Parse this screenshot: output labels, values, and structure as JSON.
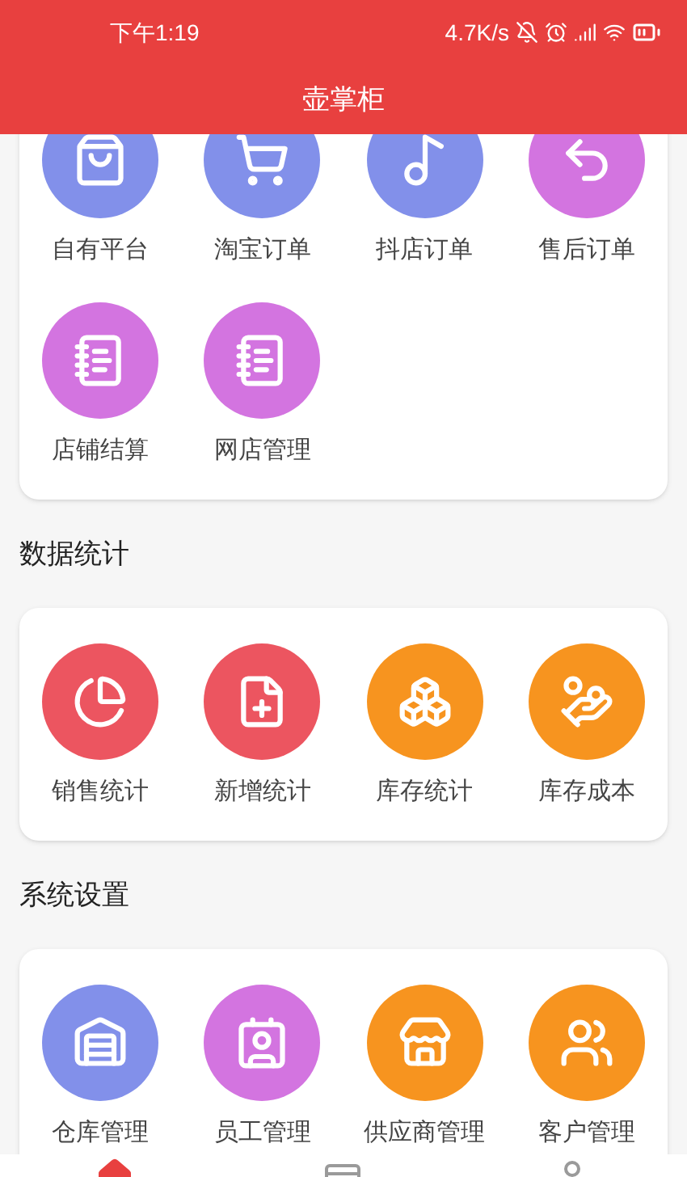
{
  "status_bar": {
    "time": "下午1:19",
    "net_speed": "4.7K/s"
  },
  "header": {
    "title": "壶掌柜"
  },
  "sections": [
    {
      "items": [
        {
          "label": "自有平台",
          "color": "#8290ea"
        },
        {
          "label": "淘宝订单",
          "color": "#8290ea"
        },
        {
          "label": "抖店订单",
          "color": "#8290ea"
        },
        {
          "label": "售后订单",
          "color": "#d374e0"
        },
        {
          "label": "店铺结算",
          "color": "#d374e0"
        },
        {
          "label": "网店管理",
          "color": "#d374e0"
        }
      ]
    },
    {
      "title": "数据统计",
      "items": [
        {
          "label": "销售统计",
          "color": "#ec5560"
        },
        {
          "label": "新增统计",
          "color": "#ec5560"
        },
        {
          "label": "库存统计",
          "color": "#f7941f"
        },
        {
          "label": "库存成本",
          "color": "#f7941f"
        }
      ]
    },
    {
      "title": "系统设置",
      "items": [
        {
          "label": "仓库管理",
          "color": "#8290ea"
        },
        {
          "label": "员工管理",
          "color": "#d374e0"
        },
        {
          "label": "供应商管理",
          "color": "#f7941f"
        },
        {
          "label": "客户管理",
          "color": "#f7941f"
        }
      ]
    }
  ],
  "tab_bar": [
    {
      "selected": true
    },
    {
      "selected": false
    },
    {
      "selected": false
    }
  ]
}
